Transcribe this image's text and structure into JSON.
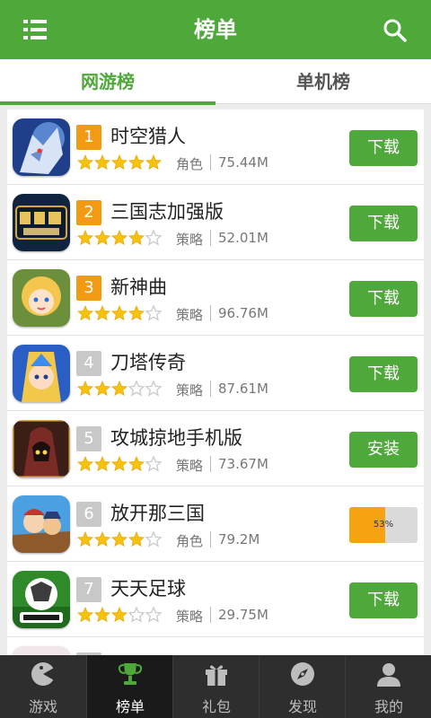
{
  "header": {
    "title": "榜单",
    "menu_icon": "menu-icon",
    "search_icon": "search-icon"
  },
  "tabs": [
    {
      "label": "网游榜",
      "active": true
    },
    {
      "label": "单机榜",
      "active": false
    }
  ],
  "colors": {
    "brand": "#4ea83a",
    "rank_top": "#f39a13",
    "rank_other": "#c8c8c8",
    "progress": "#f5a311",
    "star": "#f7c20e"
  },
  "apps": [
    {
      "rank": "1",
      "name": "时空猎人",
      "rating": 5,
      "category": "角色",
      "size": "75.44M",
      "action": "下载"
    },
    {
      "rank": "2",
      "name": "三国志加强版",
      "rating": 4,
      "category": "策略",
      "size": "52.01M",
      "action": "下载"
    },
    {
      "rank": "3",
      "name": "新神曲",
      "rating": 4,
      "category": "策略",
      "size": "96.76M",
      "action": "下载"
    },
    {
      "rank": "4",
      "name": "刀塔传奇",
      "rating": 3,
      "category": "策略",
      "size": "87.61M",
      "action": "下载"
    },
    {
      "rank": "5",
      "name": "攻城掠地手机版",
      "rating": 4,
      "category": "策略",
      "size": "73.67M",
      "action": "安装"
    },
    {
      "rank": "6",
      "name": "放开那三国",
      "rating": 4,
      "category": "角色",
      "size": "79.2M",
      "action": "",
      "progress": 0.53,
      "progress_label": "53%"
    },
    {
      "rank": "7",
      "name": "天天足球",
      "rating": 3,
      "category": "策略",
      "size": "29.75M",
      "action": "下载"
    }
  ],
  "nav": [
    {
      "label": "游戏",
      "icon": "gamepad-icon",
      "active": false
    },
    {
      "label": "榜单",
      "icon": "trophy-icon",
      "active": true
    },
    {
      "label": "礼包",
      "icon": "gift-icon",
      "active": false
    },
    {
      "label": "发现",
      "icon": "compass-icon",
      "active": false
    },
    {
      "label": "我的",
      "icon": "user-icon",
      "active": false
    }
  ]
}
